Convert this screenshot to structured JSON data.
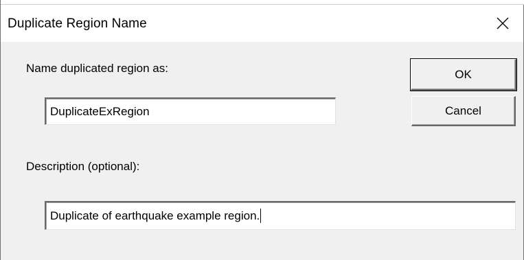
{
  "dialog": {
    "title": "Duplicate Region Name",
    "close_icon": "close-icon"
  },
  "form": {
    "name_label": "Name duplicated region as:",
    "name_value": "DuplicateExRegion",
    "description_label": "Description (optional):",
    "description_value": "Duplicate of earthquake example region."
  },
  "buttons": {
    "ok_label": "OK",
    "cancel_label": "Cancel"
  },
  "colors": {
    "dialog_background": "#f0f0f0",
    "titlebar_background": "#ffffff",
    "field_background": "#ffffff"
  }
}
